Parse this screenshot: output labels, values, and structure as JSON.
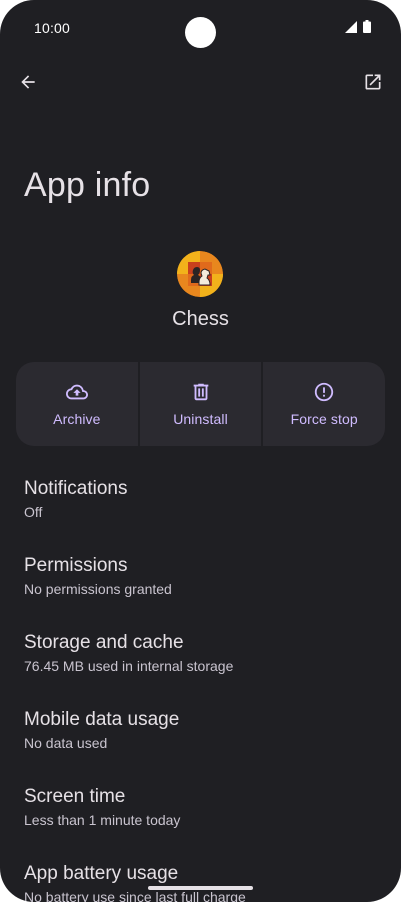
{
  "status_bar": {
    "time": "10:00"
  },
  "top_bar": {
    "back_icon": "arrow-back-icon",
    "open_icon": "open-in-new-icon"
  },
  "page": {
    "title": "App info"
  },
  "app": {
    "name": "Chess",
    "icon": "chess-app-icon"
  },
  "actions": [
    {
      "label": "Archive",
      "icon": "cloud-upload-icon"
    },
    {
      "label": "Uninstall",
      "icon": "trash-icon"
    },
    {
      "label": "Force stop",
      "icon": "alert-circle-icon"
    }
  ],
  "settings": [
    {
      "title": "Notifications",
      "subtitle": "Off"
    },
    {
      "title": "Permissions",
      "subtitle": "No permissions granted"
    },
    {
      "title": "Storage and cache",
      "subtitle": "76.45 MB used in internal storage"
    },
    {
      "title": "Mobile data usage",
      "subtitle": "No data used"
    },
    {
      "title": "Screen time",
      "subtitle": "Less than 1 minute today"
    },
    {
      "title": "App battery usage",
      "subtitle": "No battery use since last full charge"
    }
  ],
  "colors": {
    "background": "#1f1f23",
    "surface": "#2b2a30",
    "accent": "#d0bcff",
    "text_primary": "#e6e1e6",
    "text_secondary": "#c9c4cf"
  }
}
